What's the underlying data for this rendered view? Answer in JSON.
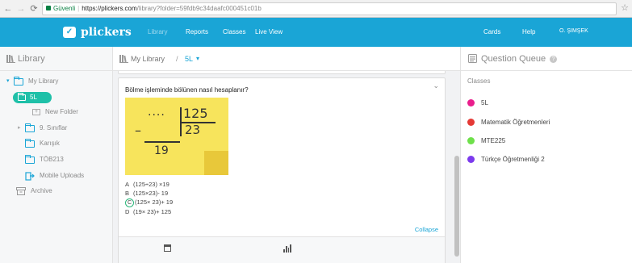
{
  "browser": {
    "back_icon": "arrow-left-icon",
    "forward_icon": "arrow-right-icon",
    "reload_icon": "reload-icon",
    "secure_label": "Güvenli",
    "url_host": "https://plickers.com",
    "url_path": "/library?folder=59fdb9c34daafc000451c01b",
    "bookmark_icon": "star-icon"
  },
  "app": {
    "logo_text": "plickers",
    "brand_color": "#1aa5d6",
    "nav": {
      "library": "Library",
      "reports": "Reports",
      "classes": "Classes",
      "live_view": "Live View",
      "cards": "Cards",
      "help": "Help",
      "user": "O. ŞIMŞEK"
    }
  },
  "sidebar": {
    "title": "Library",
    "items": [
      {
        "label": "My Library"
      },
      {
        "label": "5L"
      },
      {
        "label": "New Folder"
      },
      {
        "label": "9. Sınıflar"
      },
      {
        "label": "Karışık"
      },
      {
        "label": "TÖB213"
      },
      {
        "label": "Mobile Uploads"
      },
      {
        "label": "Archive"
      }
    ]
  },
  "main": {
    "breadcrumb": {
      "root": "My Library",
      "divider": "/",
      "current": "5L"
    },
    "question": {
      "text": "Bölme işleminde bölünen nasıl hesaplanır?",
      "image": {
        "dividend": "125",
        "dots": "····",
        "minus": "–",
        "divisor": "23",
        "remainder": "19"
      },
      "options": [
        {
          "letter": "A",
          "text": "(125÷23) ×19",
          "correct": false
        },
        {
          "letter": "B",
          "text": "(125×23)- 19",
          "correct": false
        },
        {
          "letter": "C",
          "text": "(125× 23)+ 19",
          "correct": true
        },
        {
          "letter": "D",
          "text": "(19× 23)+ 125",
          "correct": false
        }
      ],
      "collapse_label": "Collapse"
    }
  },
  "queue": {
    "title": "Question Queue",
    "help_glyph": "?",
    "classes_label": "Classes",
    "classes": [
      {
        "name": "5L",
        "color": "#e91e8c"
      },
      {
        "name": "Matematik Öğretmenleri",
        "color": "#e53935"
      },
      {
        "name": "MTE225",
        "color": "#6ee04a"
      },
      {
        "name": "Türkçe Öğretmenliği 2",
        "color": "#7c3aed"
      }
    ]
  }
}
